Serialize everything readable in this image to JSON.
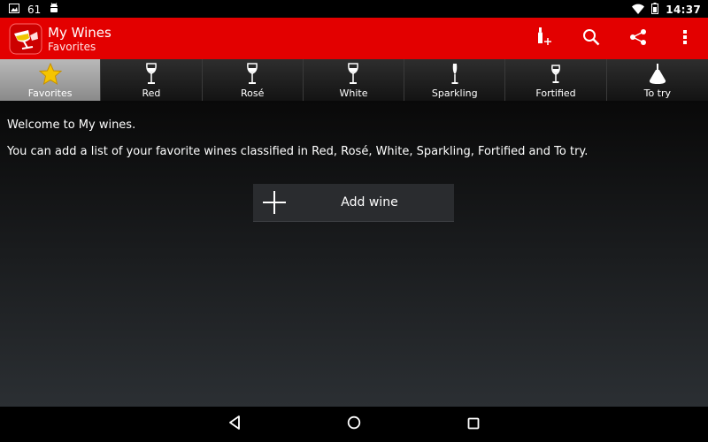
{
  "status_bar": {
    "notification_count": "61",
    "time": "14:37",
    "icons": [
      "image-icon",
      "android-icon",
      "wifi-icon",
      "battery-icon"
    ]
  },
  "action_bar": {
    "title": "My Wines",
    "subtitle": "Favorites",
    "actions": [
      "add-bottle-icon",
      "search-icon",
      "share-icon",
      "overflow-menu-icon"
    ],
    "bg_color": "#e30000"
  },
  "tabs": [
    {
      "label": "Favorites",
      "icon": "star-icon",
      "active": true
    },
    {
      "label": "Red",
      "icon": "wine-glass-icon",
      "active": false
    },
    {
      "label": "Rosé",
      "icon": "wine-glass-icon",
      "active": false
    },
    {
      "label": "White",
      "icon": "wine-glass-icon",
      "active": false
    },
    {
      "label": "Sparkling",
      "icon": "flute-glass-icon",
      "active": false
    },
    {
      "label": "Fortified",
      "icon": "fortified-glass-icon",
      "active": false
    },
    {
      "label": "To try",
      "icon": "decanter-icon",
      "active": false
    }
  ],
  "content": {
    "welcome": "Welcome to My wines.",
    "description": "You can add a list of your favorite wines classified in Red, Rosé, White, Sparkling, Fortified and To try.",
    "add_button_label": "Add wine"
  },
  "nav_bar": {
    "buttons": [
      "back-icon",
      "home-icon",
      "recents-icon"
    ]
  }
}
